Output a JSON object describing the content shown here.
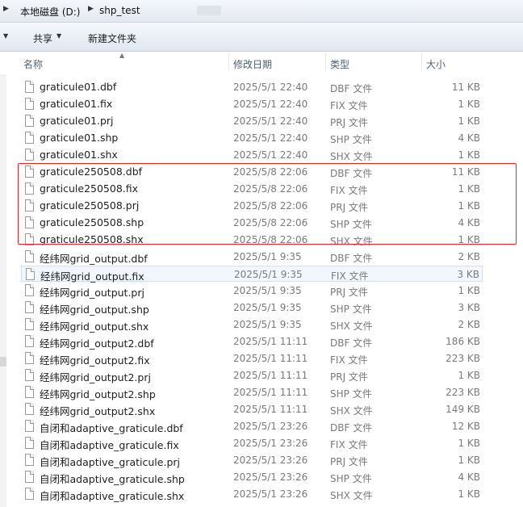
{
  "address": {
    "crumbs": [
      "本地磁盘 (D:)",
      "shp_test"
    ]
  },
  "toolbar": {
    "share_label": "共享",
    "new_folder_label": "新建文件夹"
  },
  "columns": {
    "name": "名称",
    "date": "修改日期",
    "type": "类型",
    "size": "大小"
  },
  "files": [
    {
      "name": "graticule01.dbf",
      "date": "2025/5/1 22:40",
      "type": "DBF 文件",
      "size": "11 KB"
    },
    {
      "name": "graticule01.fix",
      "date": "2025/5/1 22:40",
      "type": "FIX 文件",
      "size": "1 KB"
    },
    {
      "name": "graticule01.prj",
      "date": "2025/5/1 22:40",
      "type": "PRJ 文件",
      "size": "1 KB"
    },
    {
      "name": "graticule01.shp",
      "date": "2025/5/1 22:40",
      "type": "SHP 文件",
      "size": "4 KB"
    },
    {
      "name": "graticule01.shx",
      "date": "2025/5/1 22:40",
      "type": "SHX 文件",
      "size": "1 KB"
    },
    {
      "name": "graticule250508.dbf",
      "date": "2025/5/8 22:06",
      "type": "DBF 文件",
      "size": "11 KB"
    },
    {
      "name": "graticule250508.fix",
      "date": "2025/5/8 22:06",
      "type": "FIX 文件",
      "size": "1 KB"
    },
    {
      "name": "graticule250508.prj",
      "date": "2025/5/8 22:06",
      "type": "PRJ 文件",
      "size": "1 KB"
    },
    {
      "name": "graticule250508.shp",
      "date": "2025/5/8 22:06",
      "type": "SHP 文件",
      "size": "4 KB"
    },
    {
      "name": "graticule250508.shx",
      "date": "2025/5/8 22:06",
      "type": "SHX 文件",
      "size": "1 KB"
    },
    {
      "name": "经纬网grid_output.dbf",
      "date": "2025/5/1 9:35",
      "type": "DBF 文件",
      "size": "2 KB"
    },
    {
      "name": "经纬网grid_output.fix",
      "date": "2025/5/1 9:35",
      "type": "FIX 文件",
      "size": "3 KB"
    },
    {
      "name": "经纬网grid_output.prj",
      "date": "2025/5/1 9:35",
      "type": "PRJ 文件",
      "size": "1 KB"
    },
    {
      "name": "经纬网grid_output.shp",
      "date": "2025/5/1 9:35",
      "type": "SHP 文件",
      "size": "3 KB"
    },
    {
      "name": "经纬网grid_output.shx",
      "date": "2025/5/1 9:35",
      "type": "SHX 文件",
      "size": "2 KB"
    },
    {
      "name": "经纬网grid_output2.dbf",
      "date": "2025/5/1 11:11",
      "type": "DBF 文件",
      "size": "186 KB"
    },
    {
      "name": "经纬网grid_output2.fix",
      "date": "2025/5/1 11:11",
      "type": "FIX 文件",
      "size": "223 KB"
    },
    {
      "name": "经纬网grid_output2.prj",
      "date": "2025/5/1 11:11",
      "type": "PRJ 文件",
      "size": "1 KB"
    },
    {
      "name": "经纬网grid_output2.shp",
      "date": "2025/5/1 11:11",
      "type": "SHP 文件",
      "size": "223 KB"
    },
    {
      "name": "经纬网grid_output2.shx",
      "date": "2025/5/1 11:11",
      "type": "SHX 文件",
      "size": "149 KB"
    },
    {
      "name": "自闭和adaptive_graticule.dbf",
      "date": "2025/5/1 23:26",
      "type": "DBF 文件",
      "size": "12 KB"
    },
    {
      "name": "自闭和adaptive_graticule.fix",
      "date": "2025/5/1 23:26",
      "type": "FIX 文件",
      "size": "1 KB"
    },
    {
      "name": "自闭和adaptive_graticule.prj",
      "date": "2025/5/1 23:26",
      "type": "PRJ 文件",
      "size": "1 KB"
    },
    {
      "name": "自闭和adaptive_graticule.shp",
      "date": "2025/5/1 23:26",
      "type": "SHP 文件",
      "size": "4 KB"
    },
    {
      "name": "自闭和adaptive_graticule.shx",
      "date": "2025/5/1 23:26",
      "type": "SHX 文件",
      "size": "1 KB"
    }
  ],
  "selected_file": "经纬网grid_output.fix",
  "highlighted_files": [
    "graticule250508.dbf",
    "graticule250508.fix",
    "graticule250508.prj",
    "graticule250508.shp",
    "graticule250508.shx"
  ],
  "colors": {
    "highlight_box": "#e02a2a",
    "header_text": "#4c607a",
    "detail_text": "#7a7a7a"
  }
}
